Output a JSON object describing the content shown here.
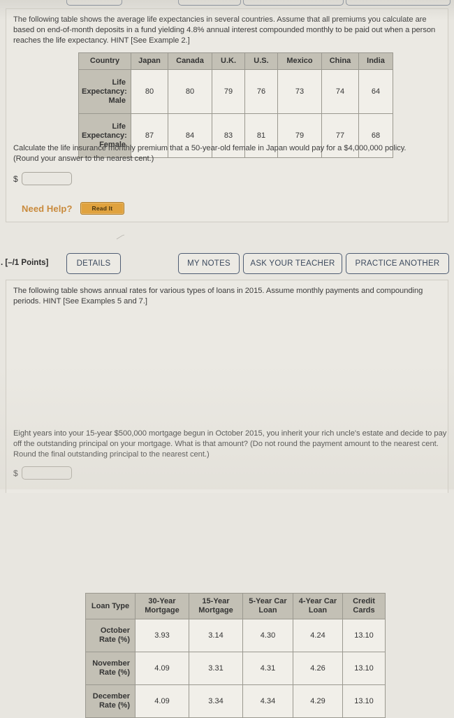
{
  "page": {
    "background_color": "#e8e6e0",
    "card_color": "#ebe9e3"
  },
  "question_one": {
    "prompt": "The following table shows the average life expectancies in several countries. Assume that all premiums you calculate are based on end-of-month deposits in a fund yielding 4.8% annual interest compounded monthly to be paid out when a person reaches the life expectancy. HINT [See Example 2.]",
    "table": {
      "corner_label": "Country",
      "columns": [
        "Japan",
        "Canada",
        "U.K.",
        "U.S.",
        "Mexico",
        "China",
        "India"
      ],
      "rows": [
        {
          "label": "Life Expectancy: Male",
          "values": [
            "80",
            "80",
            "79",
            "76",
            "73",
            "74",
            "64"
          ]
        },
        {
          "label": "Life Expectancy: Female",
          "values": [
            "87",
            "84",
            "83",
            "81",
            "79",
            "77",
            "68"
          ]
        }
      ]
    },
    "task": "Calculate the life insurance monthly premium that a 50-year-old female in Japan would pay for a $4,000,000 policy. (Round your answer to the nearest cent.)",
    "answer": {
      "currency_symbol": "$",
      "value": "",
      "placeholder": ""
    },
    "need_help": {
      "label": "Need Help?",
      "read_it_button": "Read It",
      "accent_color": "#c98a3c",
      "button_color": "#e0a23e"
    }
  },
  "question_two": {
    "points_label": ". [–/1 Points]",
    "buttons": {
      "details": "DETAILS",
      "my_notes": "MY NOTES",
      "ask_your_teacher": "ASK YOUR TEACHER",
      "practice_another": "PRACTICE ANOTHER"
    },
    "prompt": "The following table shows annual rates for various types of loans in 2015. Assume monthly payments and compounding periods. HINT [See Examples 5 and 7.]",
    "table": {
      "corner_label": "Loan Type",
      "columns": [
        "30-Year Mortgage",
        "15-Year Mortgage",
        "5-Year Car Loan",
        "4-Year Car Loan",
        "Credit Cards"
      ],
      "rows": [
        {
          "label": "October Rate (%)",
          "values": [
            "3.93",
            "3.14",
            "4.30",
            "4.24",
            "13.10"
          ]
        },
        {
          "label": "November Rate (%)",
          "values": [
            "4.09",
            "3.31",
            "4.31",
            "4.26",
            "13.10"
          ]
        },
        {
          "label": "December Rate (%)",
          "values": [
            "4.09",
            "3.34",
            "4.34",
            "4.29",
            "13.10"
          ]
        }
      ]
    },
    "task": "Eight years into your 15-year $500,000 mortgage begun in October 2015, you inherit your rich uncle's estate and decide to pay off the outstanding principal on your mortgage. What is that amount? (Do not round the payment amount to the nearest cent. Round the final outstanding principal to the nearest cent.)",
    "answer": {
      "currency_symbol": "$",
      "value": "",
      "placeholder": ""
    }
  }
}
